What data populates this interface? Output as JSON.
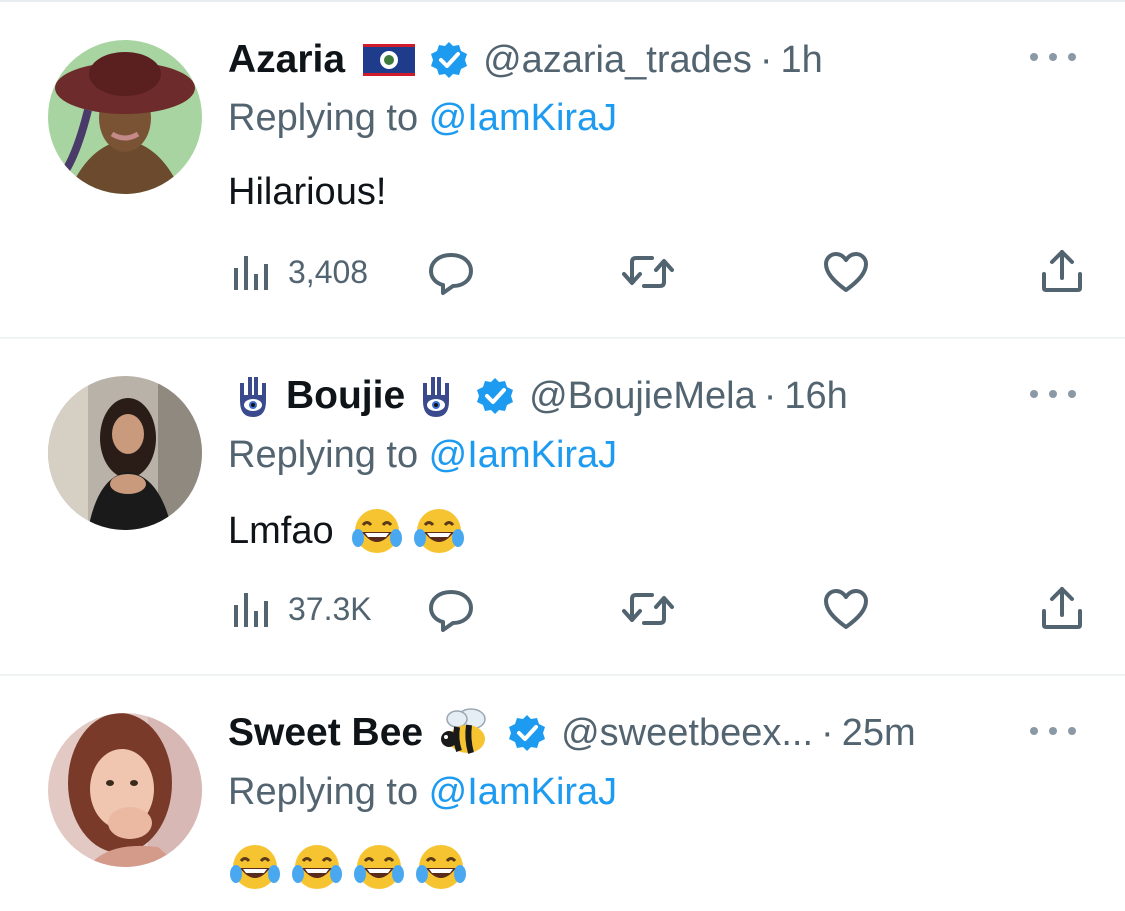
{
  "tweets": [
    {
      "name": "Azaria",
      "handle": "@azaria_trades",
      "time": "1h",
      "replying_prefix": "Replying to ",
      "replying_to": "@IamKiraJ",
      "text": "Hilarious!",
      "views": "3,408",
      "name_emoji": "belize-flag"
    },
    {
      "name": "Boujie",
      "handle": "@BoujieMela",
      "time": "16h",
      "replying_prefix": "Replying to ",
      "replying_to": "@IamKiraJ",
      "text": "Lmfao",
      "views": "37.3K",
      "name_emoji": "hamsa-hand"
    },
    {
      "name": "Sweet Bee",
      "handle": "@sweetbeex...",
      "time": "25m",
      "replying_prefix": "Replying to ",
      "replying_to": "@IamKiraJ",
      "text": "",
      "name_emoji": "bee"
    }
  ],
  "separator_dot": "·",
  "colors": {
    "verified": "#1d9bf0",
    "mention": "#1d9bf0",
    "secondary": "#536471",
    "text": "#0f1419"
  }
}
